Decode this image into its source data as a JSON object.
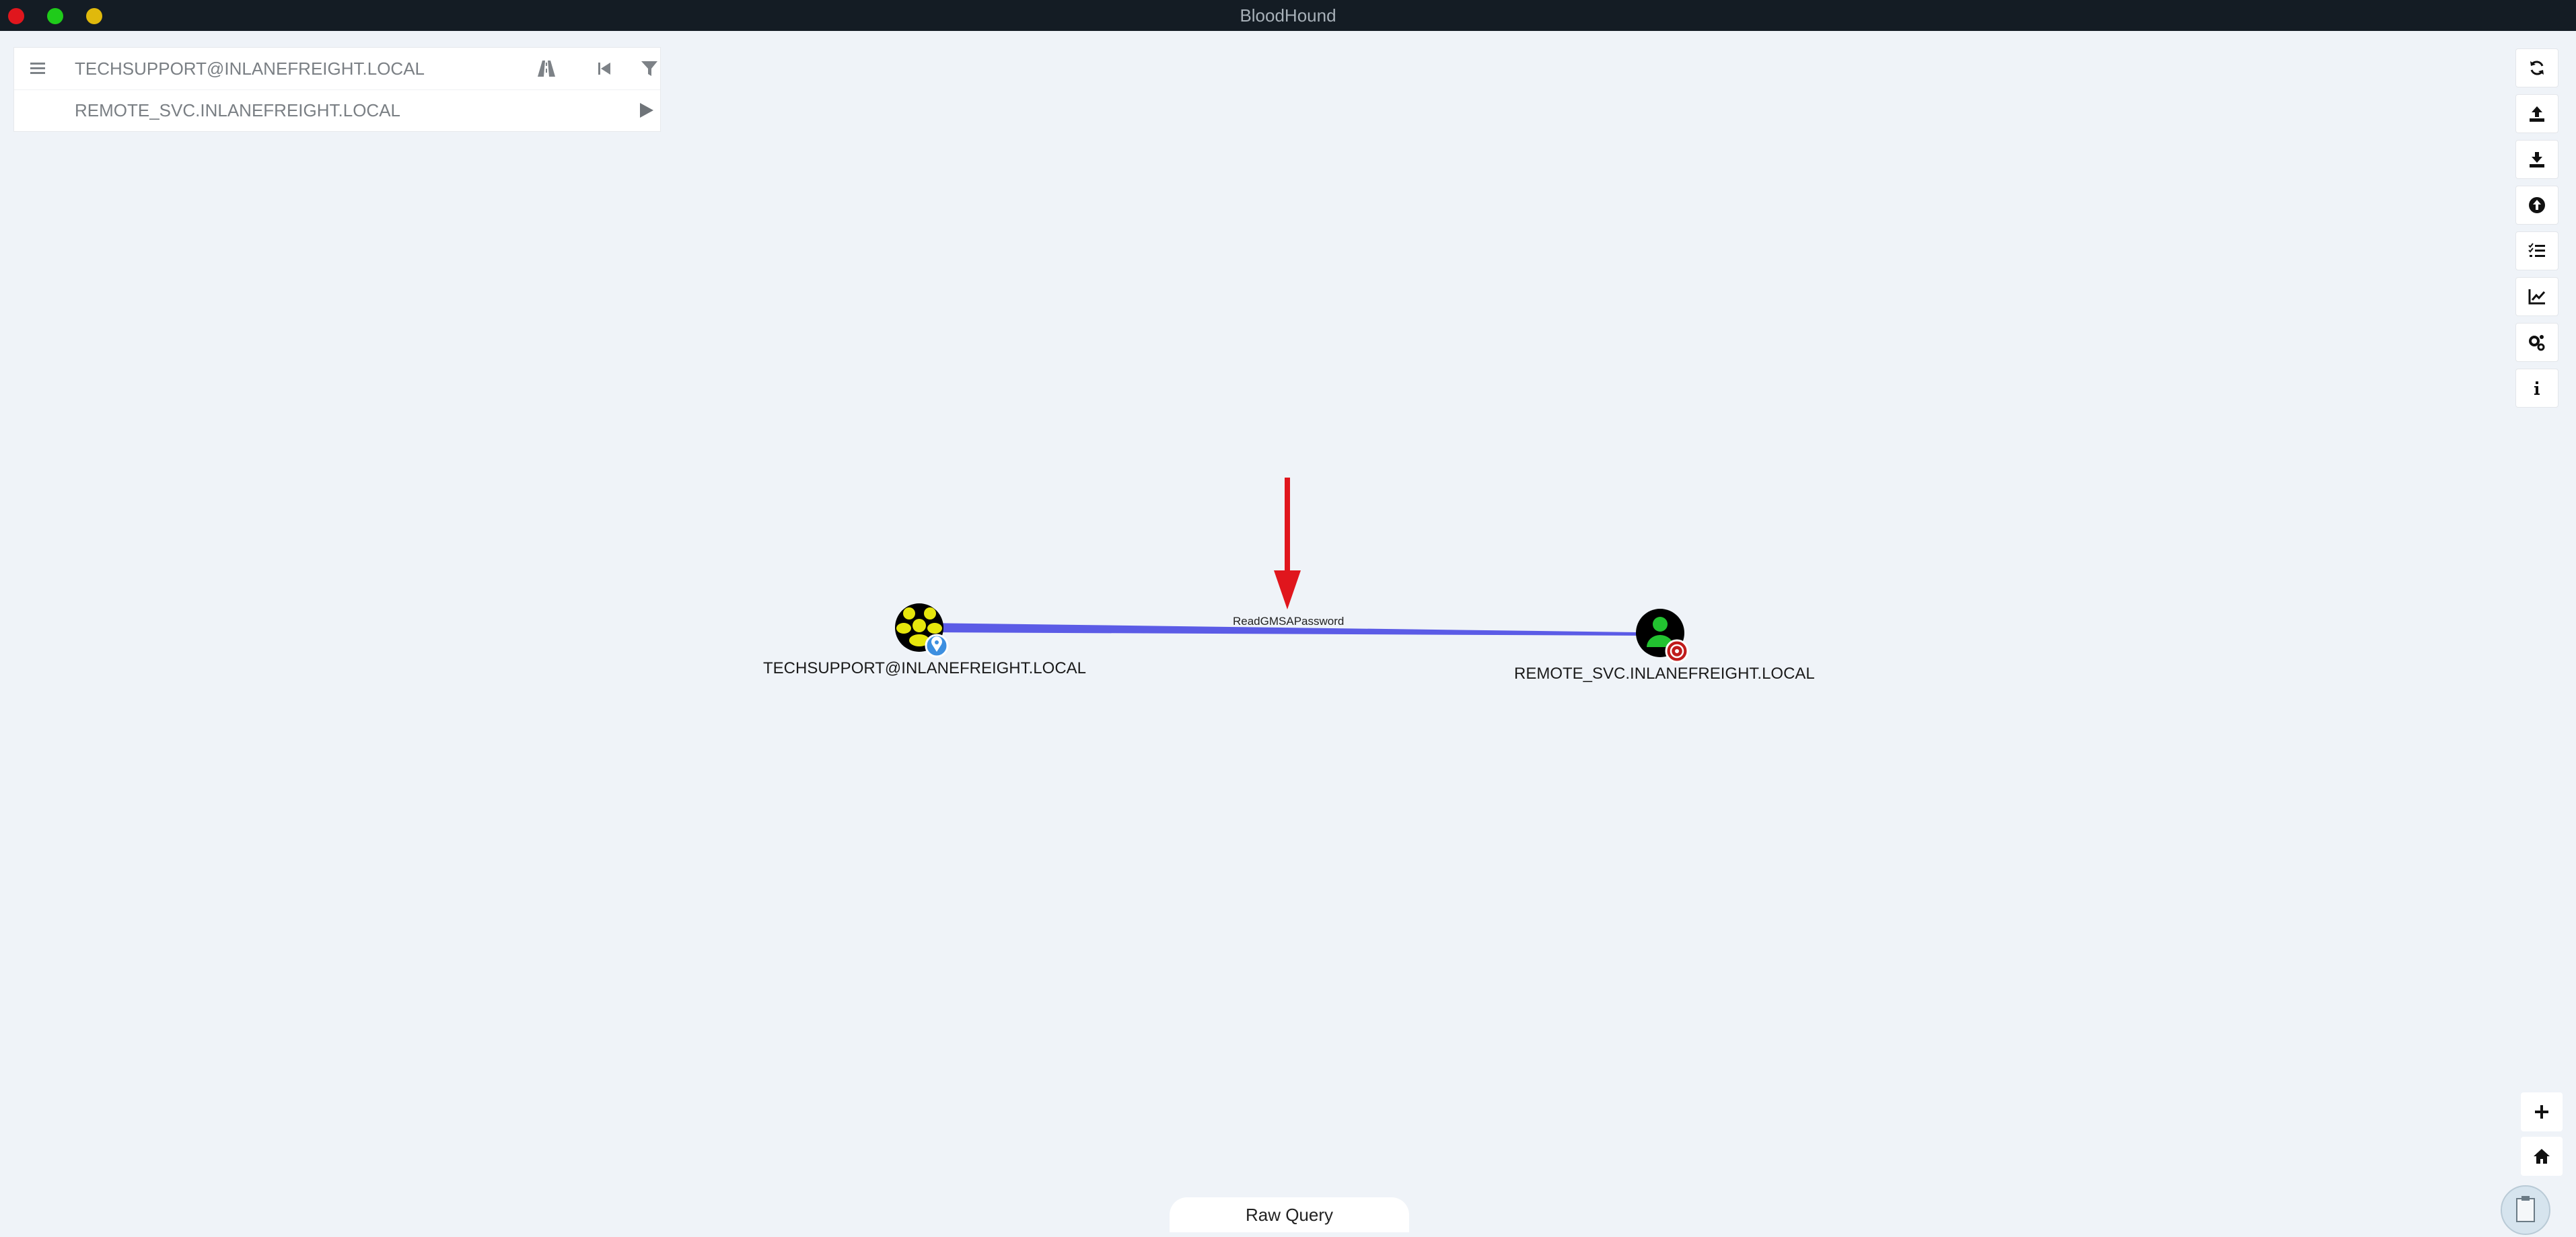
{
  "window": {
    "title": "BloodHound"
  },
  "search": {
    "start_node": "TECHSUPPORT@INLANEFREIGHT.LOCAL",
    "target_node": "REMOTE_SVC.INLANEFREIGHT.LOCAL",
    "menu_icon": "hamburger-icon",
    "path_icon": "road-icon",
    "back_icon": "step-backward-icon",
    "filter_icon": "filter-icon",
    "play_icon": "play-icon"
  },
  "toolbar": {
    "buttons": [
      "refresh-icon",
      "upload-icon",
      "download-icon",
      "arrow-circle-up-icon",
      "tasks-icon",
      "chart-line-icon",
      "cogs-icon",
      "info-icon"
    ]
  },
  "graph": {
    "nodes": [
      {
        "label": "TECHSUPPORT@INLANEFREIGHT.LOCAL",
        "type": "group",
        "badge": "owned"
      },
      {
        "label": "REMOTE_SVC.INLANEFREIGHT.LOCAL",
        "type": "user",
        "badge": "target"
      }
    ],
    "edge": {
      "label": "ReadGMSAPassword",
      "color": "#5b5be6"
    },
    "annotation_arrow_color": "#e0161d"
  },
  "controls": {
    "zoom_in_icon": "plus-icon",
    "home_icon": "home-icon",
    "raw_query_label": "Raw Query",
    "clipboard_icon": "clipboard-icon"
  }
}
